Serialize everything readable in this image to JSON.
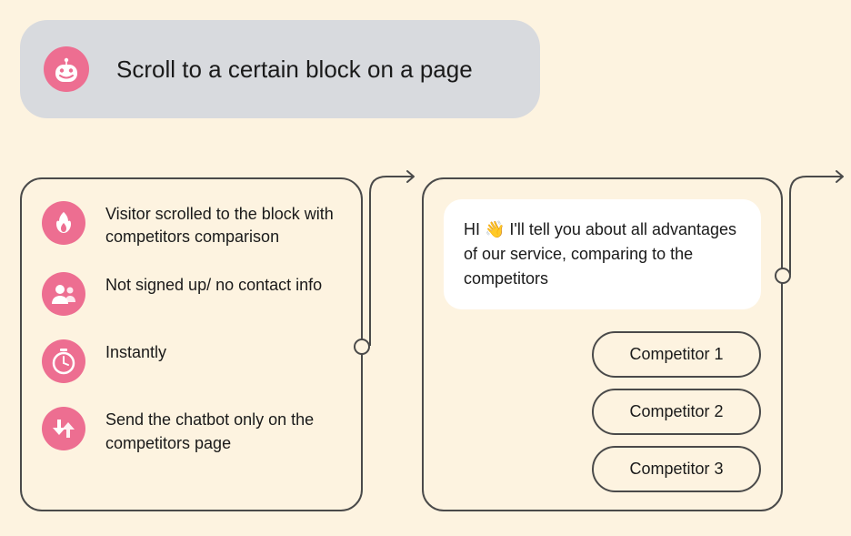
{
  "header": {
    "title": "Scroll to a certain block on a page"
  },
  "triggers": [
    {
      "text": "Visitor scrolled to the block with competitors comparison",
      "icon": "fire"
    },
    {
      "text": "Not signed up/ no contact info",
      "icon": "users"
    },
    {
      "text": "Instantly",
      "icon": "clock"
    },
    {
      "text": "Send the chatbot only on the competitors page",
      "icon": "arrows"
    }
  ],
  "chat": {
    "message": "HI 👋 I'll tell you about all advantages of our service, comparing to the competitors",
    "buttons": [
      "Competitor 1",
      "Competitor 2",
      "Competitor 3"
    ]
  }
}
